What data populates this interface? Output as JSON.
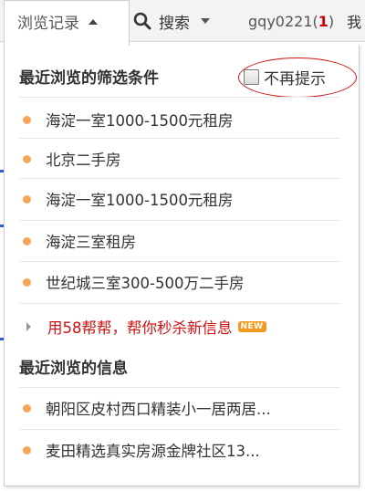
{
  "topbar": {
    "history_label": "浏览记录",
    "search_label": "搜索",
    "user_name": "gqy0221",
    "user_open_paren": "(",
    "user_count": "1",
    "user_close_paren": ")",
    "more_label": "我"
  },
  "panel": {
    "filters_title": "最近浏览的筛选条件",
    "no_prompt_label": "不再提示",
    "filters": [
      {
        "label": "海淀一室1000-1500元租房"
      },
      {
        "label": "北京二手房"
      },
      {
        "label": "海淀一室1000-1500元租房"
      },
      {
        "label": "海淀三室租房"
      },
      {
        "label": "世纪城三室300-500万二手房"
      }
    ],
    "promo_label": "用58帮帮，帮你秒杀新信息",
    "promo_badge": "NEW",
    "info_title": "最近浏览的信息",
    "infos": [
      {
        "label": "朝阳区皮村西口精装小一居两居..."
      },
      {
        "label": "麦田精选真实房源金牌社区13..."
      }
    ]
  },
  "colors": {
    "accent_red": "#d01010",
    "bullet_orange": "#f5a65b",
    "badge_orange": "#f39a1e"
  }
}
